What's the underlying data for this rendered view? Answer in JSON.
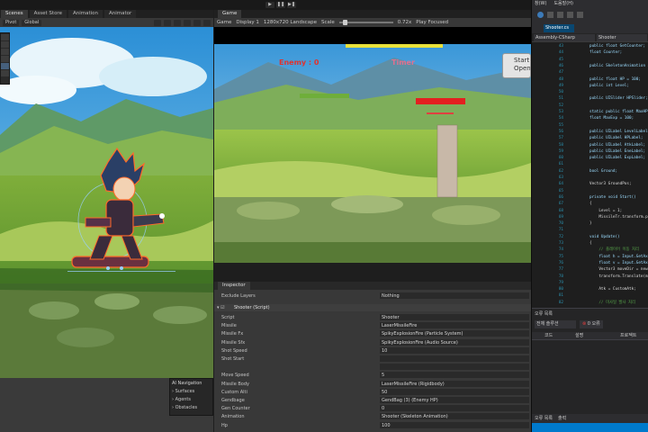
{
  "editor": {
    "play_controls": [
      "▶",
      "❚❚",
      "▶❚"
    ],
    "scene_tabs": [
      {
        "label": "Scenes",
        "active": true
      },
      {
        "label": "Asset Store",
        "active": false
      },
      {
        "label": "Animation",
        "active": false
      },
      {
        "label": "Animator",
        "active": false
      }
    ],
    "scene_toolbar": {
      "pivot": "Pivot",
      "space": "Global"
    },
    "tools": [
      "hand-tool",
      "move-tool",
      "rotate-tool",
      "scale-tool",
      "rect-tool",
      "transform-tool"
    ],
    "ai_navigation": {
      "title": "AI Navigation",
      "items": [
        "Surfaces",
        "Agents",
        "Obstacles"
      ]
    }
  },
  "game": {
    "tab_label": "Game",
    "toolbar": {
      "mode": "Game",
      "display": "Display 1",
      "resolution": "1280x720 Landscape",
      "scale_label": "Scale",
      "scale_value": "0.72x",
      "play_focus": "Play Focused"
    },
    "hud": {
      "enemy_label": "Enemy : 0",
      "timer_label": "Timer",
      "start_button": "Start",
      "open_button": "Open"
    }
  },
  "inspector": {
    "tab_label": "Inspector",
    "exclude_layers_label": "Exclude Layers",
    "exclude_layers_value": "Nothing",
    "component_title": "Shooter (Script)",
    "fields": [
      {
        "label": "Script",
        "value": "Shooter"
      },
      {
        "label": "Missile",
        "value": "LaserMissileFire"
      },
      {
        "label": "Missile Fx",
        "value": "SpikyExplosionFire (Particle System)"
      },
      {
        "label": "Missile Sfx",
        "value": "SpikyExplosionFire (Audio Source)"
      },
      {
        "label": "Shot Speed",
        "value": "10"
      },
      {
        "label": "Shot Start",
        "value": ""
      },
      {
        "label": "",
        "value": ""
      },
      {
        "label": "Move Speed",
        "value": "5"
      },
      {
        "label": "Missile Body",
        "value": "LaserMissileFire (Rigidbody)"
      },
      {
        "label": "Custom Alti",
        "value": "50"
      },
      {
        "label": "Gendbage",
        "value": "GendBag (3) (Enemy HP)"
      },
      {
        "label": "Gen Counter",
        "value": "0"
      },
      {
        "label": "Animation",
        "value": "Shooter (Skeleton Animation)"
      },
      {
        "label": "Hp",
        "value": "100"
      }
    ]
  },
  "vs": {
    "menu": [
      "창(W)",
      "도움말(H)"
    ],
    "file_tab": "Shooter.cs",
    "nav_left": "Assembly-CSharp",
    "nav_right": "Shooter",
    "code": [
      {
        "ln": "43",
        "text": "public float GetCounter;"
      },
      {
        "ln": "44",
        "text": "float Counter;"
      },
      {
        "ln": "45",
        "text": ""
      },
      {
        "ln": "46",
        "text": "public SkeletonAnimation ani;"
      },
      {
        "ln": "47",
        "text": ""
      },
      {
        "ln": "48",
        "text": "public float HP = 100;"
      },
      {
        "ln": "49",
        "text": "public int Level;"
      },
      {
        "ln": "50",
        "text": ""
      },
      {
        "ln": "51",
        "text": "public UISlider HPSlider;"
      },
      {
        "ln": "52",
        "text": ""
      },
      {
        "ln": "53",
        "text": "static public float MaxHP;"
      },
      {
        "ln": "54",
        "text": "float MaxExp = 100;"
      },
      {
        "ln": "55",
        "text": ""
      },
      {
        "ln": "56",
        "text": "public UILabel LevelLabel;"
      },
      {
        "ln": "57",
        "text": "public UILabel HPLabel;"
      },
      {
        "ln": "58",
        "text": "public UILabel AtkLabel;"
      },
      {
        "ln": "59",
        "text": "public UILabel EneLabel;"
      },
      {
        "ln": "60",
        "text": "public UILabel ExpLabel;"
      },
      {
        "ln": "61",
        "text": ""
      },
      {
        "ln": "62",
        "text": "bool Ground;"
      },
      {
        "ln": "63",
        "text": ""
      },
      {
        "ln": "64",
        "text": "Vector3 GroundPos;"
      },
      {
        "ln": "65",
        "text": ""
      },
      {
        "ln": "66",
        "text": "private void Start()"
      },
      {
        "ln": "67",
        "text": "{"
      },
      {
        "ln": "68",
        "text": "    Level = 1;"
      },
      {
        "ln": "69",
        "text": "    MissileTr.transform.p"
      },
      {
        "ln": "70",
        "text": "}"
      },
      {
        "ln": "71",
        "text": ""
      },
      {
        "ln": "72",
        "text": "void Update()"
      },
      {
        "ln": "73",
        "text": "{"
      },
      {
        "ln": "74",
        "text": "    // 플레이어 이동 처리"
      },
      {
        "ln": "75",
        "text": "    float h = Input.GetAxis"
      },
      {
        "ln": "76",
        "text": "    float v = Input.GetAxis"
      },
      {
        "ln": "77",
        "text": "    Vector3 moveDir = new"
      },
      {
        "ln": "78",
        "text": "    transform.Translate(m"
      },
      {
        "ln": "79",
        "text": ""
      },
      {
        "ln": "80",
        "text": "    Atk = CustomAtk;"
      },
      {
        "ln": "81",
        "text": ""
      },
      {
        "ln": "82",
        "text": "    // 미사일 발사 처리"
      }
    ],
    "error_panel": {
      "title": "오류 목록",
      "scope": "전체 솔루션",
      "errors": "0 오류",
      "col_code": "코드",
      "col_desc": "설명",
      "col_project": "프로젝트"
    },
    "bottom_tabs": [
      "오류 목록",
      "출력"
    ]
  },
  "colors": {
    "unity_bg": "#383838",
    "vs_bg": "#1e1e1e",
    "enemy_text": "#e0332e",
    "timer_text": "#e07090",
    "hp_bar": "#e32020",
    "accent_blue": "#007acc"
  }
}
